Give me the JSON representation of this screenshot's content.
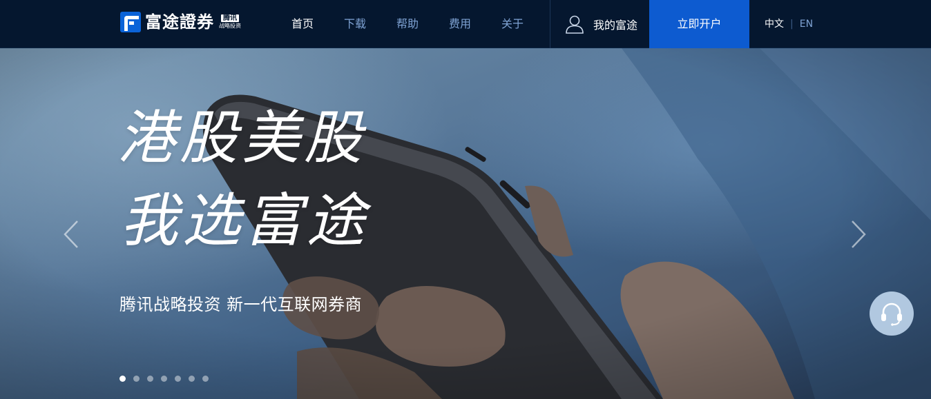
{
  "header": {
    "logo_text": "富途證券",
    "logo_badge_top": "腾讯",
    "logo_badge_bottom": "战略投资",
    "nav": [
      {
        "label": "首页",
        "active": true
      },
      {
        "label": "下载",
        "active": false
      },
      {
        "label": "帮助",
        "active": false
      },
      {
        "label": "费用",
        "active": false
      },
      {
        "label": "关于",
        "active": false
      }
    ],
    "account_label": "我的富途",
    "open_account_label": "立即开户",
    "lang_zh": "中文",
    "lang_separator": "|",
    "lang_en": "EN"
  },
  "banner": {
    "slogan_line1": "港股美股",
    "slogan_line2": "我选富途",
    "subtitle": "腾讯战略投资 新一代互联网券商",
    "slide_count": 7,
    "active_slide": 1
  },
  "icons": {
    "user": "user-icon",
    "prev": "chevron-left-icon",
    "next": "chevron-right-icon",
    "support": "headset-icon"
  },
  "colors": {
    "header_bg": "#05172f",
    "accent_blue": "#0d5bd0",
    "nav_inactive": "#7fa3d4"
  }
}
